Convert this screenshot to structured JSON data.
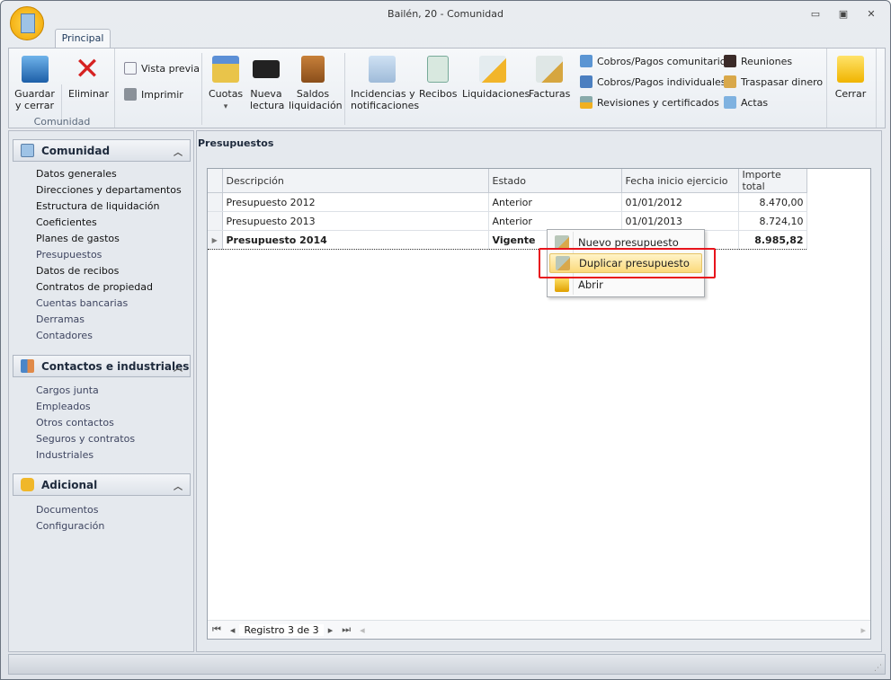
{
  "window": {
    "title": "Bailén, 20 - Comunidad",
    "minimize": "▭",
    "restore": "▣",
    "close": "✕"
  },
  "tabs": [
    {
      "label": "Principal"
    }
  ],
  "ribbon": {
    "group_label": "Comunidad",
    "guardar": "Guardar\ny cerrar",
    "eliminar": "Eliminar",
    "vista_previa": "Vista previa",
    "imprimir": "Imprimir",
    "cuotas": "Cuotas",
    "cuotas_arrow": "▾",
    "nueva_lectura": "Nueva\nlectura",
    "saldos": "Saldos\nliquidación",
    "incidencias": "Incidencias y\nnotificaciones",
    "recibos": "Recibos",
    "liquidaciones": "Liquidaciones",
    "facturas": "Facturas",
    "cobros_comunitarios": "Cobros/Pagos comunitarios",
    "cobros_individuales": "Cobros/Pagos individuales",
    "revisiones": "Revisiones y certificados",
    "reuniones": "Reuniones",
    "traspasar": "Traspasar dinero",
    "actas": "Actas",
    "cerrar": "Cerrar"
  },
  "sidebar": {
    "groups": [
      {
        "title": "Comunidad",
        "items": [
          "Datos generales",
          "Direcciones y departamentos",
          "Estructura de liquidación",
          "Coeficientes",
          "Planes de gastos",
          "Presupuestos",
          "Datos de recibos",
          "Contratos de propiedad",
          "Cuentas bancarias",
          "Derramas",
          "Contadores"
        ]
      },
      {
        "title": "Contactos e industriales",
        "items": [
          "Cargos junta",
          "Empleados",
          "Otros contactos",
          "Seguros y contratos",
          "Industriales"
        ]
      },
      {
        "title": "Adicional",
        "items": [
          "Documentos",
          "Configuración"
        ]
      }
    ]
  },
  "main": {
    "title": "Presupuestos",
    "columns": [
      "Descripción",
      "Estado",
      "Fecha inicio ejercicio",
      "Importe total"
    ],
    "rows": [
      [
        "Presupuesto 2012",
        "Anterior",
        "01/01/2012",
        "8.470,00"
      ],
      [
        "Presupuesto 2013",
        "Anterior",
        "01/01/2013",
        "8.724,10"
      ],
      [
        "Presupuesto 2014",
        "Vigente",
        "",
        "8.985,82"
      ]
    ],
    "navigator": "Registro 3 de 3"
  },
  "context_menu": [
    "Nuevo presupuesto",
    "Duplicar presupuesto",
    "Abrir"
  ]
}
